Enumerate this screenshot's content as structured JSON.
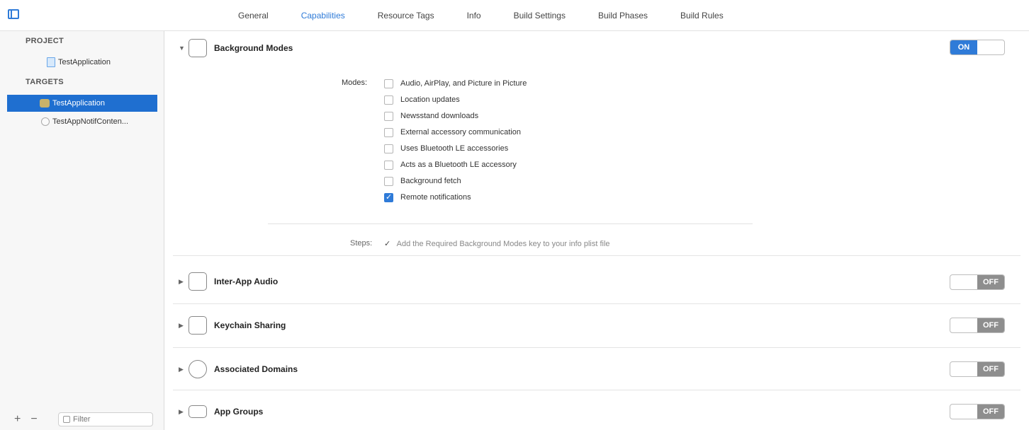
{
  "tabs": [
    "General",
    "Capabilities",
    "Resource Tags",
    "Info",
    "Build Settings",
    "Build Phases",
    "Build Rules"
  ],
  "active_tab": "Capabilities",
  "sidebar": {
    "project_heading": "PROJECT",
    "project_item": "TestApplication",
    "targets_heading": "TARGETS",
    "targets": [
      {
        "label": "TestApplication",
        "selected": true
      },
      {
        "label": "TestAppNotifConten...",
        "selected": false
      }
    ],
    "add_label": "+",
    "remove_label": "−",
    "filter_placeholder": "Filter"
  },
  "capabilities": {
    "background_modes": {
      "title": "Background Modes",
      "toggle": "ON",
      "modes_label": "Modes:",
      "modes": [
        {
          "label": "Audio, AirPlay, and Picture in Picture",
          "checked": false
        },
        {
          "label": "Location updates",
          "checked": false
        },
        {
          "label": "Newsstand downloads",
          "checked": false
        },
        {
          "label": "External accessory communication",
          "checked": false
        },
        {
          "label": "Uses Bluetooth LE accessories",
          "checked": false
        },
        {
          "label": "Acts as a Bluetooth LE accessory",
          "checked": false
        },
        {
          "label": "Background fetch",
          "checked": false
        },
        {
          "label": "Remote notifications",
          "checked": true
        }
      ],
      "steps_label": "Steps:",
      "step_check": "✓",
      "step_text": "Add the Required Background Modes key to your info plist file"
    },
    "inter_app_audio": {
      "title": "Inter-App Audio",
      "toggle": "OFF"
    },
    "keychain_sharing": {
      "title": "Keychain Sharing",
      "toggle": "OFF"
    },
    "associated_domains": {
      "title": "Associated Domains",
      "toggle": "OFF"
    },
    "app_groups": {
      "title": "App Groups",
      "toggle": "OFF"
    }
  },
  "colors": {
    "accent": "#2f7bd8",
    "selection": "#1f6fd0",
    "toggle_off": "#8e8e8e"
  }
}
